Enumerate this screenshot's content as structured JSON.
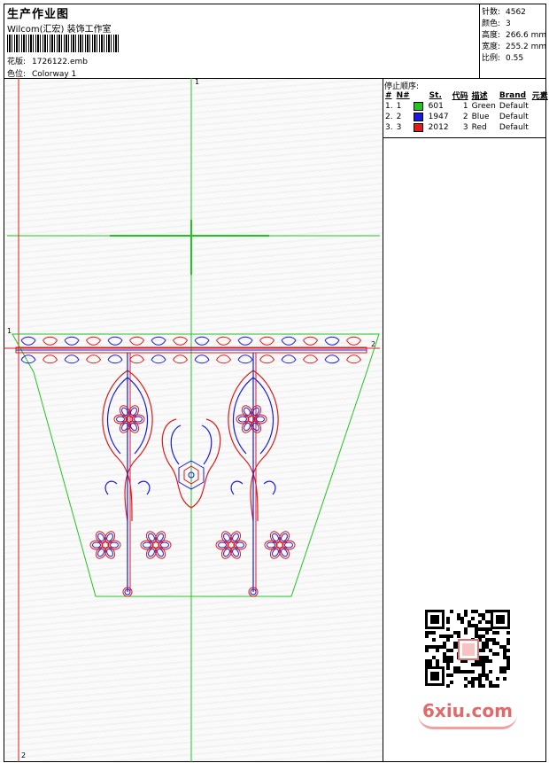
{
  "header": {
    "title": "生产作业图",
    "studio": "Wilcom(汇宏) 装饰工作室",
    "design_label": "花版:",
    "design_value": "1726122.emb",
    "colorway_label": "色位:",
    "colorway_value": "Colorway 1"
  },
  "stats": [
    {
      "label": "针数:",
      "value": "4562"
    },
    {
      "label": "颜色:",
      "value": "3"
    },
    {
      "label": "高度:",
      "value": "266.6 mm"
    },
    {
      "label": "宽度:",
      "value": "255.2 mm"
    },
    {
      "label": "比例:",
      "value": "0.55"
    }
  ],
  "stop_sequence": {
    "title": "停止顺序:",
    "columns": [
      "#",
      "N#",
      "St.",
      "代码",
      "描述",
      "Brand",
      "元素"
    ],
    "rows": [
      {
        "num": "1.",
        "n": "1",
        "color": "#22c422",
        "code": "601",
        "st": "1",
        "desc": "Green",
        "brand": "Default"
      },
      {
        "num": "2.",
        "n": "2",
        "color": "#1a1adc",
        "code": "1947",
        "st": "2",
        "desc": "Blue",
        "brand": "Default"
      },
      {
        "num": "3.",
        "n": "3",
        "color": "#e01a1a",
        "code": "2012",
        "st": "3",
        "desc": "Red",
        "brand": "Default"
      }
    ]
  },
  "axis_labels": {
    "top": "1",
    "left_top": "1",
    "right": "2",
    "bottom": "2"
  },
  "watermark": "6xiu.com",
  "colors": {
    "green": "#22c422",
    "blue": "#1a1adc",
    "red": "#e01a1a"
  }
}
